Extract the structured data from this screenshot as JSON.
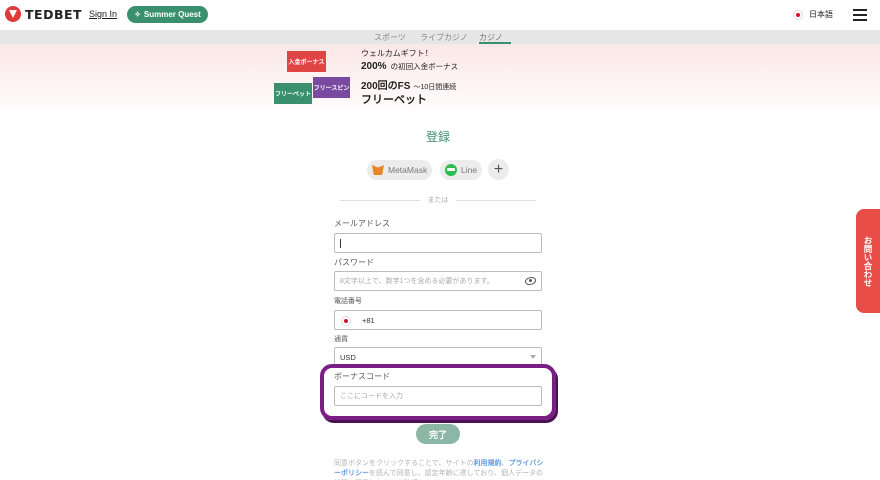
{
  "header": {
    "logo_text": "TEDBET",
    "signin": "Sign In",
    "quest": "Summer Quest",
    "language": "日本語"
  },
  "nav": {
    "tabs": [
      "スポーツ",
      "ライブカジノ",
      "カジノ"
    ],
    "active": "カジノ"
  },
  "banner": {
    "hex_labels": [
      "入金ボーナス",
      "フリースピン",
      "フリーベット"
    ],
    "line1": "ウェルカムギフト！",
    "line2_main": "200%",
    "line2_sub": "の初回入金ボーナス",
    "line3_main": "200回のFS",
    "line3_sub": "～10日間連続",
    "line4": "フリーベット"
  },
  "form": {
    "title": "登録",
    "social": [
      "MetaMask",
      "Line"
    ],
    "divider": "または",
    "email_label": "メールアドレス",
    "password_label": "パスワード",
    "password_placeholder": "8文字以上で、数字1つを含める必要があります。",
    "phone_label": "電話番号",
    "phone_code": "+81",
    "currency_label": "通貨",
    "currency_value": "USD",
    "bonus_label": "ボーナスコード",
    "bonus_placeholder": "ここにコードを入力",
    "submit": "完了",
    "terms_text": "同意ボタンをクリックすることで、サイトの",
    "terms_link1": "利用規約",
    "terms_link2": "プライバシーポリシー",
    "terms_tail": "を読んで同意し、認定年齢に達しており、個人データの処理に同意したことを確認します。"
  },
  "side": {
    "contact": "お問い合わせ"
  },
  "colors": {
    "brand_green": "#3a8f6e",
    "brand_red": "#e94d47",
    "highlight": "#7a1e86"
  }
}
